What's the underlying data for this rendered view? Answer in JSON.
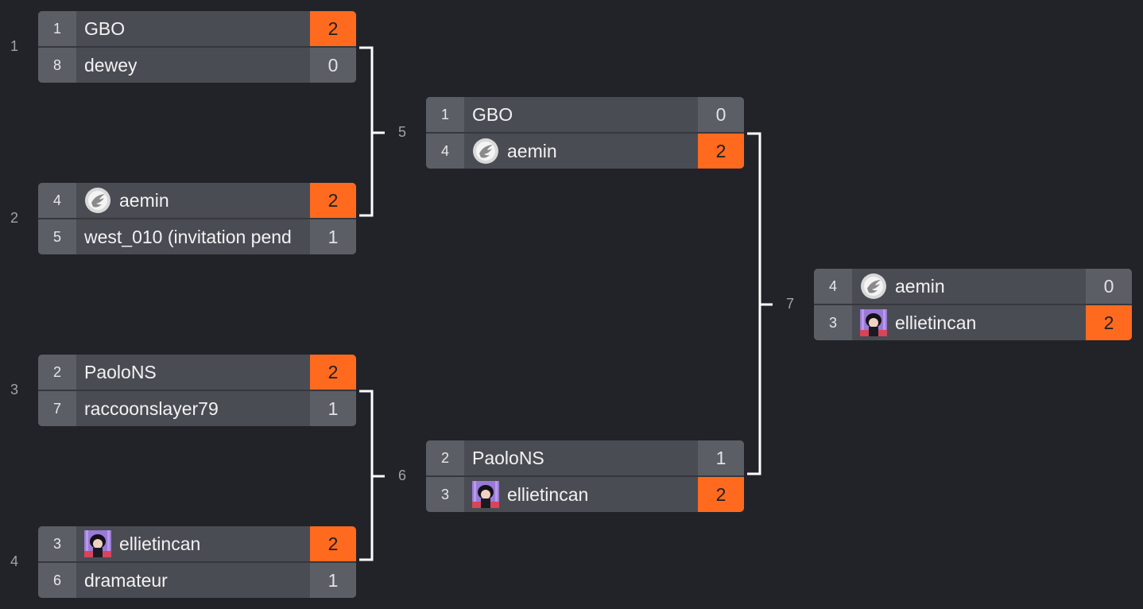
{
  "colors": {
    "background": "#212329",
    "winner_score": "#ff6a1f",
    "connector": "#ffffff"
  },
  "bracket": {
    "matches": [
      {
        "number": "1",
        "players": [
          {
            "seed": "1",
            "name": "GBO",
            "avatar": "",
            "score": "2",
            "winner": true
          },
          {
            "seed": "8",
            "name": "dewey",
            "avatar": "",
            "score": "0",
            "winner": false
          }
        ]
      },
      {
        "number": "2",
        "players": [
          {
            "seed": "4",
            "name": "aemin",
            "avatar": "wing-logo-icon",
            "score": "2",
            "winner": true
          },
          {
            "seed": "5",
            "name": "west_010 (invitation pend",
            "avatar": "",
            "score": "1",
            "winner": false
          }
        ]
      },
      {
        "number": "3",
        "players": [
          {
            "seed": "2",
            "name": "PaoloNS",
            "avatar": "",
            "score": "2",
            "winner": true
          },
          {
            "seed": "7",
            "name": "raccoonslayer79",
            "avatar": "",
            "score": "1",
            "winner": false
          }
        ]
      },
      {
        "number": "4",
        "players": [
          {
            "seed": "3",
            "name": "ellietincan",
            "avatar": "character-avatar-icon",
            "score": "2",
            "winner": true
          },
          {
            "seed": "6",
            "name": "dramateur",
            "avatar": "",
            "score": "1",
            "winner": false
          }
        ]
      },
      {
        "number": "5",
        "players": [
          {
            "seed": "1",
            "name": "GBO",
            "avatar": "",
            "score": "0",
            "winner": false
          },
          {
            "seed": "4",
            "name": "aemin",
            "avatar": "wing-logo-icon",
            "score": "2",
            "winner": true
          }
        ]
      },
      {
        "number": "6",
        "players": [
          {
            "seed": "2",
            "name": "PaoloNS",
            "avatar": "",
            "score": "1",
            "winner": false
          },
          {
            "seed": "3",
            "name": "ellietincan",
            "avatar": "character-avatar-icon",
            "score": "2",
            "winner": true
          }
        ]
      },
      {
        "number": "7",
        "players": [
          {
            "seed": "4",
            "name": "aemin",
            "avatar": "wing-logo-icon",
            "score": "0",
            "winner": false
          },
          {
            "seed": "3",
            "name": "ellietincan",
            "avatar": "character-avatar-icon",
            "score": "2",
            "winner": true
          }
        ]
      }
    ]
  }
}
